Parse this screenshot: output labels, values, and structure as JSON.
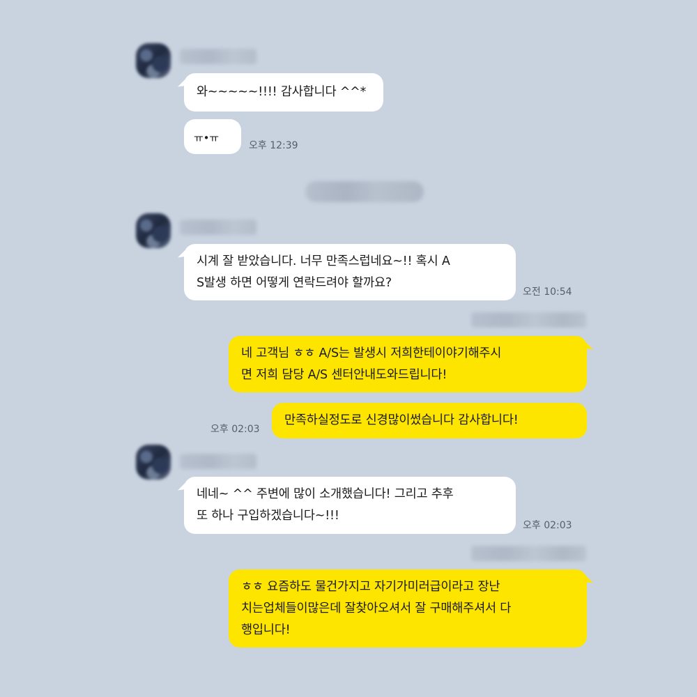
{
  "colors": {
    "background": "#c9d3e0",
    "incoming_bubble": "#ffffff",
    "outgoing_bubble": "#fee500",
    "timestamp": "#555d6b"
  },
  "messages": [
    {
      "direction": "incoming",
      "text": "와~~~~~!!!! 감사합니다 ^^*"
    },
    {
      "direction": "incoming",
      "text": "ㅠ•ㅠ",
      "time": "오후 12:39"
    },
    {
      "direction": "incoming",
      "line1": "시계 잘 받았습니다. 너무 만족스럽네요~!! 혹시 A",
      "line2": "S발생 하면 어떻게 연락드려야 할까요?",
      "time": "오전 10:54"
    },
    {
      "direction": "outgoing",
      "line1": "네 고객님 ㅎㅎ A/S는 발생시 저희한테이야기해주시",
      "line2": "면 저희 담당 A/S 센터안내도와드립니다!"
    },
    {
      "direction": "outgoing",
      "text": "만족하실정도로 신경많이썼습니다 감사합니다!",
      "time": "오후 02:03"
    },
    {
      "direction": "incoming",
      "line1": "네네~ ^^ 주변에 많이 소개했습니다! 그리고 추후",
      "line2": "또 하나 구입하겠습니다~!!!",
      "time": "오후 02:03"
    },
    {
      "direction": "outgoing",
      "line1": "ㅎㅎ 요즘하도 물건가지고 자기가미러급이라고 장난",
      "line2": "치는업체들이많은데 잘찾아오셔서 잘 구매해주셔서 다",
      "line3": "행입니다!"
    }
  ]
}
